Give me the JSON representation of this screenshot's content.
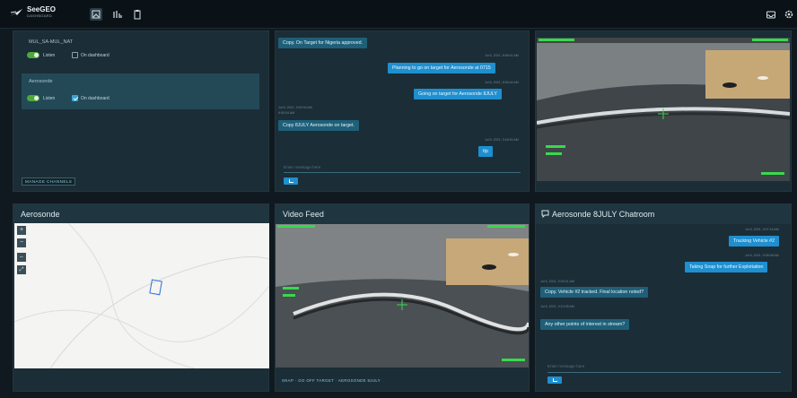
{
  "app": {
    "brand": "SeeGEO",
    "subtitle": "DASHBOARD"
  },
  "nav": {
    "tabs": [
      "dashboard",
      "analytics",
      "documents"
    ]
  },
  "channels": {
    "items": [
      {
        "name": "MUL_SA-MUL_NAT",
        "listen": "Listen",
        "on_dashboard": "On dashboard",
        "dashboard_checked": false
      },
      {
        "name": "Aerosonde",
        "listen": "Listen",
        "on_dashboard": "On dashboard",
        "dashboard_checked": true
      }
    ],
    "manage_label": "MANAGE CHANNELS"
  },
  "chat_top": {
    "messages": [
      {
        "dir": "in",
        "text": "Copy. On Target for Nigeria approved."
      },
      {
        "dir": "out",
        "time": "Jul 6, 2021, 8:58:01 AM",
        "text": "Planning to go on target for Aerosonde at 0715"
      },
      {
        "dir": "out",
        "time": "Jul 6, 2021, 8:59:44 AM",
        "text": "Going on target for Aerosonde 8JULY"
      },
      {
        "dir": "in",
        "time": "Jul 6, 2021, 9:00:04 AM",
        "sender": "9:00:04 AM",
        "text": "Copy 8JULY Aerosonde on target."
      },
      {
        "dir": "out",
        "time": "Jul 6, 2021, 9:18:00 AM",
        "text": "ttp"
      }
    ],
    "placeholder": "Enter message here"
  },
  "map": {
    "title": "Aerosonde",
    "controls": [
      "+",
      "−",
      "⇔",
      "⤢"
    ]
  },
  "feed": {
    "title": "Video Feed",
    "actions": "SNAP · GO OFF TARGET · AEROSONDE 8JULY"
  },
  "chat_bottom": {
    "title": "Aerosonde 8JULY Chatroom",
    "messages": [
      {
        "dir": "out",
        "time": "Jul 6, 2021, 9:07:16 AM",
        "text": "Tracking Vehicle #2"
      },
      {
        "dir": "out",
        "time": "Jul 6, 2021, 9:08:08 AM",
        "text": "Taking Snap for further Exploitation"
      },
      {
        "dir": "in",
        "time": "Jul 6, 2021, 9:09:21 AM",
        "text": "Copy. Vehicle #2 tracked. Final location noted?"
      },
      {
        "dir": "in",
        "time": "Jul 6, 2021, 9:10:05 AM",
        "text": "Any other points of interest in stream?"
      }
    ],
    "placeholder": "Enter message here"
  },
  "colors": {
    "accent": "#1e8fcf",
    "toggle": "#4fa83c",
    "panel": "#1b2d37"
  },
  "icons": {
    "logo": "plane-icon",
    "chat": "chat-icon",
    "settings": "gear-icon",
    "notify": "inbox-icon"
  }
}
